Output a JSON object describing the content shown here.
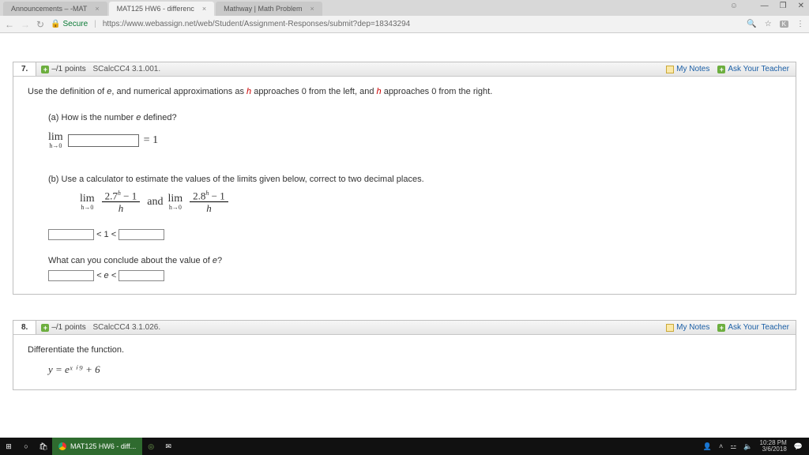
{
  "browser": {
    "tabs": [
      {
        "label": "Announcements – -MAT"
      },
      {
        "label": "MAT125 HW6 - differenc"
      },
      {
        "label": "Mathway | Math Problem"
      }
    ],
    "secure_label": "Secure",
    "url": "https://www.webassign.net/web/Student/Assignment-Responses/submit?dep=18343294"
  },
  "links": {
    "my_notes": "My Notes",
    "ask": "Ask Your Teacher"
  },
  "q7": {
    "num": "7.",
    "pts": "–/1 points",
    "ref": "SCalcCC4 3.1.001.",
    "intro_pre": "Use the definition of ",
    "intro_e": "e",
    "intro_mid": ", and numerical approximations as ",
    "intro_h1": "h",
    "intro_mid2": " approaches 0 from the left, and ",
    "intro_h2": "h",
    "intro_end": " approaches 0 from the right.",
    "a_label": "(a) How is the number ",
    "a_e": "e",
    "a_end": " defined?",
    "lim": "lim",
    "harrow": "h→0",
    "eq1": " = 1",
    "b_label": "(b) Use a calculator to estimate the values of the limits given below, correct to two decimal places.",
    "frac1n": "2.7",
    "frac2n": "2.8",
    "hexp": "h",
    "minus1": " − 1",
    "fracd": "h",
    "and": "  and  ",
    "lt1": " < 1 < ",
    "conclude": "What can you conclude about the value of ",
    "conclude_e": "e",
    "qmark": "?",
    "lte": " < e < "
  },
  "q8": {
    "num": "8.",
    "pts": "–/1 points",
    "ref": "SCalcCC4 3.1.026.",
    "label": "Differentiate the function.",
    "eqn": "y = eˣ ⁱ ⁹ + 6"
  },
  "taskbar": {
    "app": "MAT125 HW6 - diff...",
    "time": "10:28 PM",
    "date": "3/6/2018"
  }
}
